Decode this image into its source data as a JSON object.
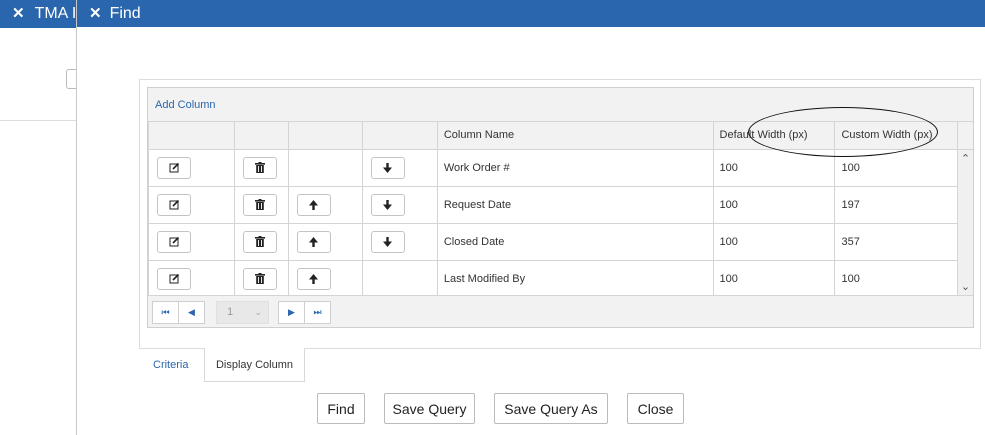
{
  "background_window": {
    "title": "TMA I",
    "close_glyph": "✕"
  },
  "dialog": {
    "title": "Find",
    "close_glyph": "✕"
  },
  "grid": {
    "add_column_label": "Add Column",
    "headers": [
      "",
      "",
      "",
      "",
      "Column Name",
      "Default Width (px)",
      "Custom Width (px)"
    ],
    "rows": [
      {
        "column_name": "Work Order #",
        "default_width": "100",
        "custom_width": "100",
        "move_up": false,
        "move_down": true
      },
      {
        "column_name": "Request Date",
        "default_width": "100",
        "custom_width": "197",
        "move_up": true,
        "move_down": true
      },
      {
        "column_name": "Closed Date",
        "default_width": "100",
        "custom_width": "357",
        "move_up": true,
        "move_down": true
      },
      {
        "column_name": "Last Modified By",
        "default_width": "100",
        "custom_width": "100",
        "move_up": true,
        "move_down": false
      }
    ],
    "icons": {
      "edit": "edit-icon",
      "delete": "trash-icon",
      "move_up": "arrow-up-icon",
      "move_down": "arrow-down-icon"
    }
  },
  "pager": {
    "first": "⏮",
    "prev": "◀",
    "page": "1",
    "next": "▶",
    "last": "⏭"
  },
  "tabs": [
    {
      "label": "Criteria",
      "active": false
    },
    {
      "label": "Display Column",
      "active": true
    }
  ],
  "buttons": {
    "find": "Find",
    "save_query": "Save Query",
    "save_query_as": "Save Query As",
    "close": "Close"
  },
  "colors": {
    "titlebar": "#2a66ad",
    "link": "#2a66ad"
  }
}
